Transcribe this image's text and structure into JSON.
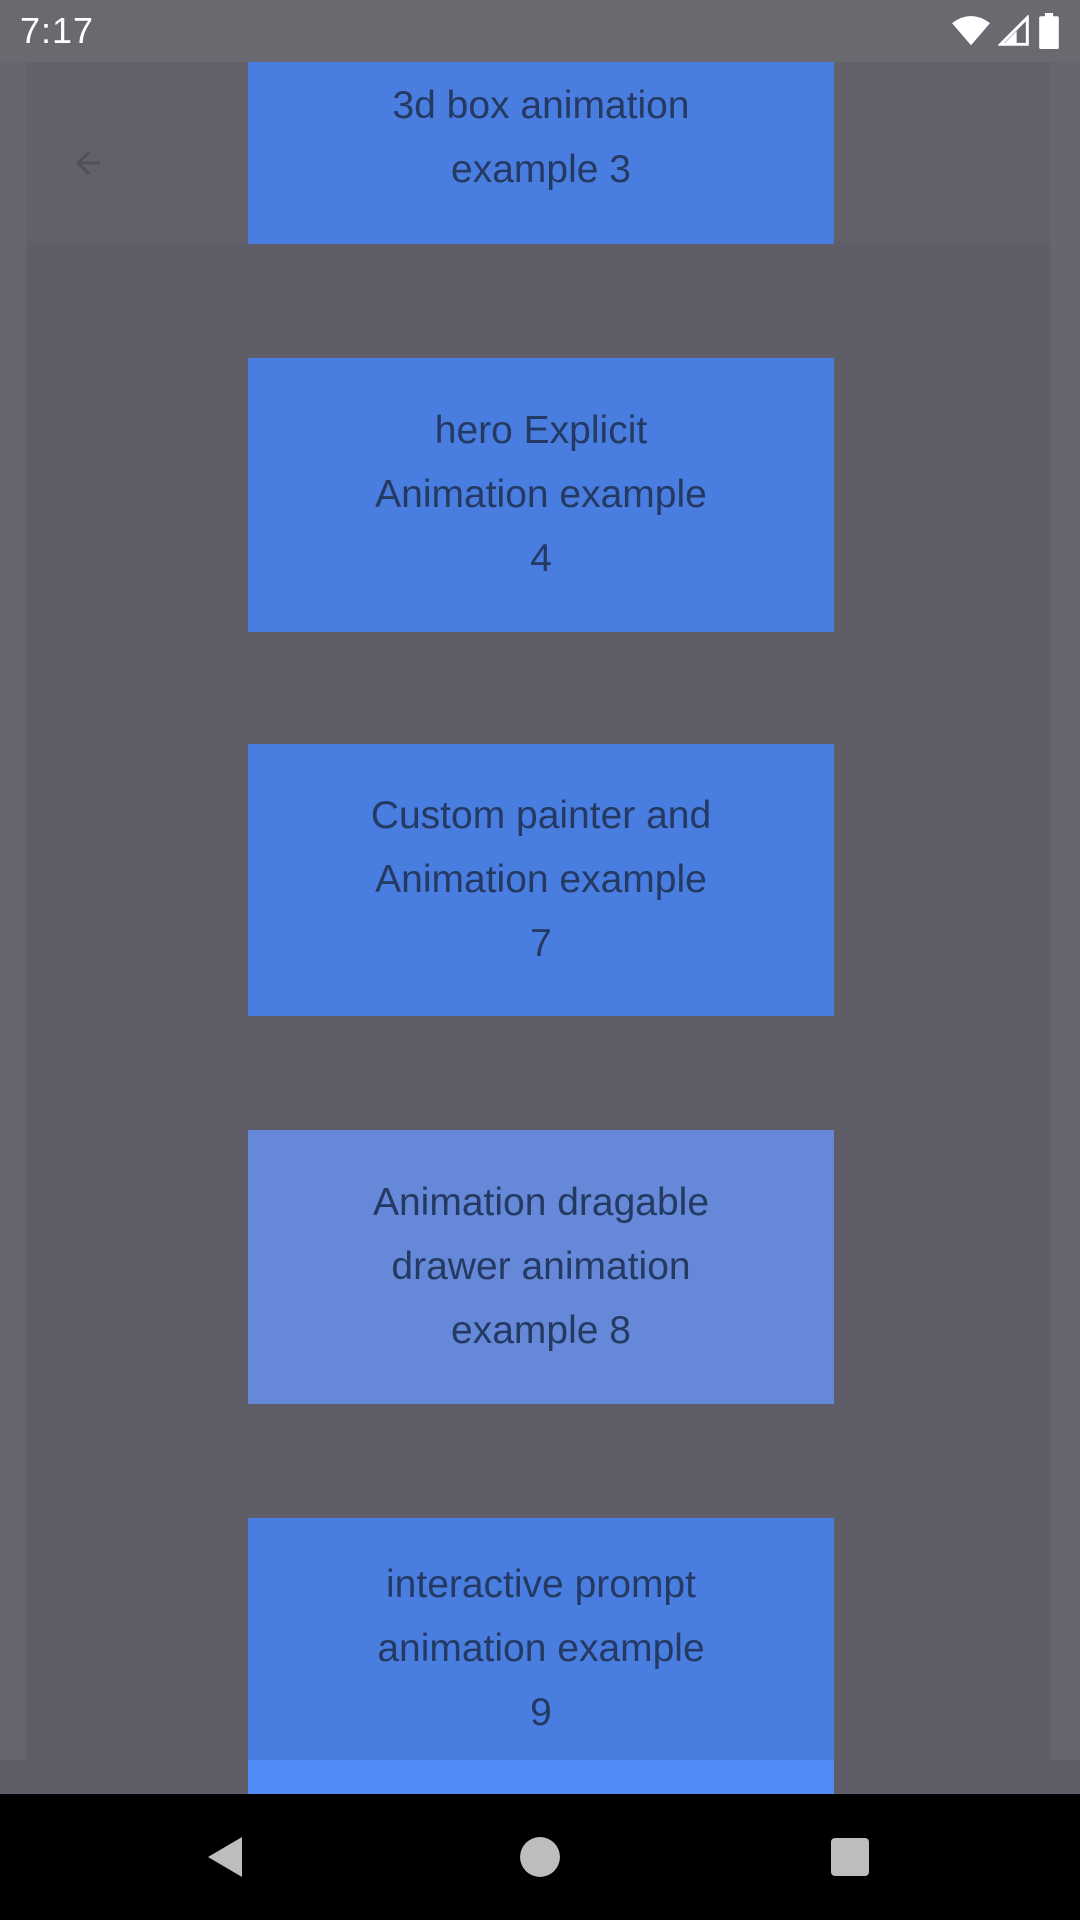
{
  "status_bar": {
    "time": "7:17",
    "icons": [
      "wifi-icon",
      "cell-signal-icon",
      "battery-icon"
    ]
  },
  "app_bar": {
    "back_icon": "back-arrow-icon"
  },
  "tiles": [
    {
      "label": "3d box animation\nexample 3"
    },
    {
      "label": "hero Explicit\nAnimation example\n4"
    },
    {
      "label": "Custom painter and\nAnimation example\n7"
    },
    {
      "label": "Animation dragable\ndrawer animation\nexample 8"
    },
    {
      "label": "interactive prompt\nanimation example\n9"
    }
  ],
  "nav_bar": {
    "buttons": [
      "back-icon",
      "home-icon",
      "recents-icon"
    ]
  },
  "colors": {
    "scrim": "#5e5d68",
    "tile": "#4a7de0",
    "tile_pressed": "#6588d8",
    "tile_text": "#243a63"
  }
}
